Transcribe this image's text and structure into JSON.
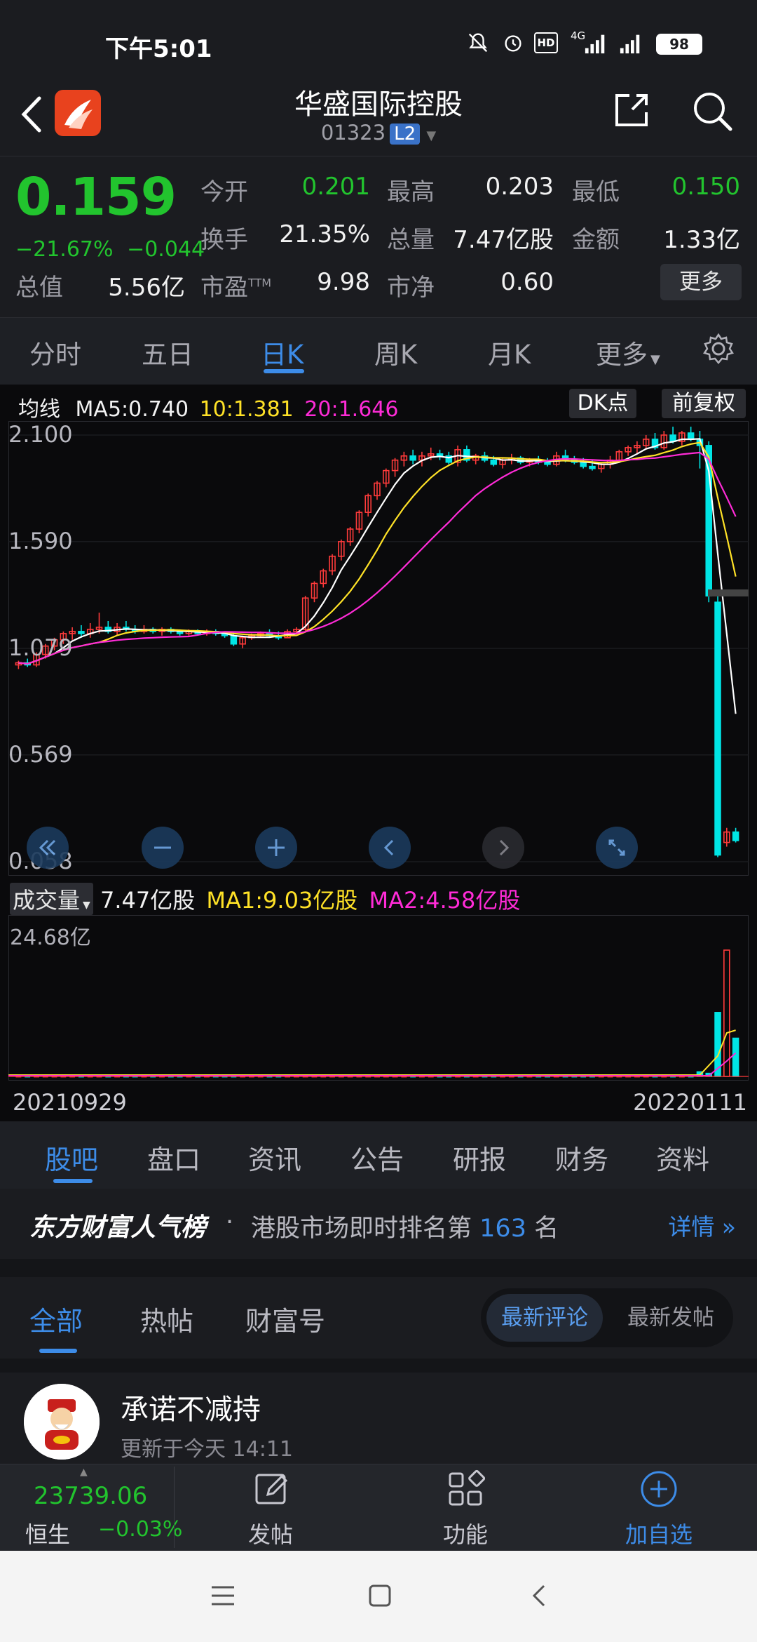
{
  "status_bar": {
    "time": "下午5:01",
    "signal_label": "4G",
    "battery": "98"
  },
  "header": {
    "title": "华盛国际控股",
    "code": "01323",
    "level_badge": "L2"
  },
  "quote": {
    "price": "0.159",
    "change_pct": "−21.67%",
    "change_abs": "−0.044",
    "fields": {
      "open_label": "今开",
      "open": "0.201",
      "high_label": "最高",
      "high": "0.203",
      "low_label": "最低",
      "low": "0.150",
      "turnover_label": "换手",
      "turnover": "21.35%",
      "volume_label": "总量",
      "volume": "7.47亿股",
      "amount_label": "金额",
      "amount": "1.33亿",
      "mcap_label": "总值",
      "mcap": "5.56亿",
      "pe_label": "市盈",
      "pe_sup": "TTM",
      "pe": "9.98",
      "pb_label": "市净",
      "pb": "0.60"
    },
    "more_label": "更多"
  },
  "period_tabs": [
    {
      "label": "分时"
    },
    {
      "label": "五日"
    },
    {
      "label": "日K"
    },
    {
      "label": "周K"
    },
    {
      "label": "月K"
    },
    {
      "label": "更多"
    }
  ],
  "active_period": "日K",
  "ma_legend": {
    "label": "均线",
    "ma5": "MA5:0.740",
    "ma10": "10:1.381",
    "ma20": "20:1.646"
  },
  "chart_buttons": {
    "dk": "DK点",
    "adjust": "前复权"
  },
  "volume_legend": {
    "label": "成交量",
    "vol": "7.47亿股",
    "ma1": "MA1:9.03亿股",
    "ma2": "MA2:4.58亿股",
    "max": "24.68亿"
  },
  "colors": {
    "up": "#ff3b3b",
    "down": "#00e5e5",
    "ma5": "#ffffff",
    "ma10": "#ffe227",
    "ma20": "#ff2bd7",
    "accent": "#3d8ce8",
    "price_down": "#22c42e"
  },
  "chart_data": {
    "type": "candlestick",
    "y_ticks": [
      "2.100",
      "1.590",
      "1.079",
      "0.569",
      "0.058"
    ],
    "ylim": [
      0.058,
      2.1
    ],
    "x_start": "20210929",
    "x_end": "20220111",
    "grid": true,
    "ohlc": [
      [
        1.0,
        1.02,
        0.98,
        1.01
      ],
      [
        1.01,
        1.03,
        0.99,
        1.0
      ],
      [
        1.0,
        1.06,
        0.99,
        1.05
      ],
      [
        1.05,
        1.1,
        1.03,
        1.09
      ],
      [
        1.09,
        1.13,
        1.07,
        1.12
      ],
      [
        1.12,
        1.16,
        1.1,
        1.15
      ],
      [
        1.15,
        1.18,
        1.12,
        1.16
      ],
      [
        1.16,
        1.19,
        1.13,
        1.15
      ],
      [
        1.15,
        1.2,
        1.13,
        1.17
      ],
      [
        1.17,
        1.25,
        1.15,
        1.18
      ],
      [
        1.18,
        1.21,
        1.15,
        1.16
      ],
      [
        1.16,
        1.2,
        1.14,
        1.18
      ],
      [
        1.18,
        1.21,
        1.16,
        1.17
      ],
      [
        1.17,
        1.19,
        1.15,
        1.16
      ],
      [
        1.16,
        1.19,
        1.15,
        1.17
      ],
      [
        1.17,
        1.18,
        1.15,
        1.16
      ],
      [
        1.16,
        1.18,
        1.14,
        1.17
      ],
      [
        1.17,
        1.18,
        1.15,
        1.16
      ],
      [
        1.16,
        1.17,
        1.14,
        1.15
      ],
      [
        1.15,
        1.17,
        1.14,
        1.16
      ],
      [
        1.16,
        1.17,
        1.14,
        1.15
      ],
      [
        1.15,
        1.17,
        1.14,
        1.16
      ],
      [
        1.16,
        1.17,
        1.14,
        1.15
      ],
      [
        1.15,
        1.16,
        1.13,
        1.14
      ],
      [
        1.14,
        1.16,
        1.09,
        1.1
      ],
      [
        1.1,
        1.14,
        1.08,
        1.13
      ],
      [
        1.13,
        1.15,
        1.12,
        1.14
      ],
      [
        1.14,
        1.16,
        1.13,
        1.15
      ],
      [
        1.15,
        1.17,
        1.13,
        1.14
      ],
      [
        1.14,
        1.16,
        1.12,
        1.13
      ],
      [
        1.13,
        1.17,
        1.13,
        1.16
      ],
      [
        1.16,
        1.18,
        1.15,
        1.17
      ],
      [
        1.17,
        1.33,
        1.16,
        1.32
      ],
      [
        1.32,
        1.4,
        1.3,
        1.39
      ],
      [
        1.39,
        1.46,
        1.37,
        1.45
      ],
      [
        1.45,
        1.53,
        1.43,
        1.52
      ],
      [
        1.52,
        1.6,
        1.5,
        1.59
      ],
      [
        1.59,
        1.66,
        1.57,
        1.65
      ],
      [
        1.65,
        1.74,
        1.63,
        1.73
      ],
      [
        1.73,
        1.82,
        1.71,
        1.81
      ],
      [
        1.81,
        1.88,
        1.79,
        1.87
      ],
      [
        1.87,
        1.94,
        1.85,
        1.93
      ],
      [
        1.93,
        1.99,
        1.9,
        1.98
      ],
      [
        1.98,
        2.02,
        1.95,
        2.0
      ],
      [
        2.0,
        2.03,
        1.96,
        1.98
      ],
      [
        1.98,
        2.02,
        1.95,
        2.0
      ],
      [
        2.0,
        2.04,
        1.98,
        2.01
      ],
      [
        2.01,
        2.03,
        1.98,
        2.0
      ],
      [
        2.0,
        2.02,
        1.96,
        1.97
      ],
      [
        1.97,
        2.05,
        1.95,
        2.03
      ],
      [
        2.03,
        2.05,
        1.97,
        1.98
      ],
      [
        1.98,
        2.01,
        1.96,
        2.0
      ],
      [
        2.0,
        2.02,
        1.97,
        1.98
      ],
      [
        1.98,
        2.0,
        1.95,
        1.96
      ],
      [
        1.96,
        1.99,
        1.94,
        1.98
      ],
      [
        1.98,
        2.01,
        1.96,
        1.99
      ],
      [
        1.99,
        2.0,
        1.96,
        1.97
      ],
      [
        1.97,
        1.99,
        1.95,
        1.98
      ],
      [
        1.98,
        2.0,
        1.96,
        1.97
      ],
      [
        1.97,
        1.99,
        1.95,
        1.96
      ],
      [
        1.96,
        2.02,
        1.95,
        2.0
      ],
      [
        2.0,
        2.03,
        1.97,
        1.98
      ],
      [
        1.98,
        2.0,
        1.96,
        1.97
      ],
      [
        1.97,
        1.99,
        1.94,
        1.95
      ],
      [
        1.95,
        1.98,
        1.93,
        1.94
      ],
      [
        1.94,
        1.97,
        1.92,
        1.96
      ],
      [
        1.96,
        2.0,
        1.94,
        1.98
      ],
      [
        1.98,
        2.03,
        1.97,
        2.02
      ],
      [
        2.02,
        2.05,
        2.0,
        2.04
      ],
      [
        2.04,
        2.07,
        2.01,
        2.05
      ],
      [
        2.05,
        2.1,
        2.03,
        2.08
      ],
      [
        2.08,
        2.11,
        2.03,
        2.04
      ],
      [
        2.04,
        2.12,
        2.03,
        2.1
      ],
      [
        2.1,
        2.14,
        2.06,
        2.07
      ],
      [
        2.07,
        2.12,
        2.05,
        2.11
      ],
      [
        2.11,
        2.14,
        2.07,
        2.08
      ],
      [
        2.08,
        2.12,
        1.94,
        2.05
      ],
      [
        2.05,
        2.07,
        1.3,
        1.33
      ],
      [
        1.3,
        1.34,
        0.08,
        0.09
      ],
      [
        0.15,
        0.22,
        0.13,
        0.2
      ],
      [
        0.2,
        0.22,
        0.15,
        0.159
      ]
    ],
    "ma5_end": 0.74,
    "ma10_end": 1.381,
    "ma20_end": 1.646,
    "volume_max": 24.68,
    "volume_recent": [
      0.9,
      0.6,
      12.5,
      24.68,
      7.47
    ]
  },
  "content_tabs": [
    {
      "label": "股吧"
    },
    {
      "label": "盘口"
    },
    {
      "label": "资讯"
    },
    {
      "label": "公告"
    },
    {
      "label": "研报"
    },
    {
      "label": "财务"
    },
    {
      "label": "资料"
    }
  ],
  "rank": {
    "title": "东方财富人气榜",
    "text_prefix": "港股市场即时排名第",
    "rank": "163",
    "text_suffix": "名",
    "detail": "详情"
  },
  "filters": {
    "all": "全部",
    "hot": "热帖",
    "fortune": "财富号",
    "sort_comment": "最新评论",
    "sort_post": "最新发帖"
  },
  "post": {
    "title": "承诺不减持",
    "time": "更新于今天 14:11"
  },
  "bottom_nav": {
    "index_value": "23739.06",
    "index_name": "恒生",
    "index_change": "−0.03%",
    "post_label": "发帖",
    "func_label": "功能",
    "add_label": "加自选"
  }
}
